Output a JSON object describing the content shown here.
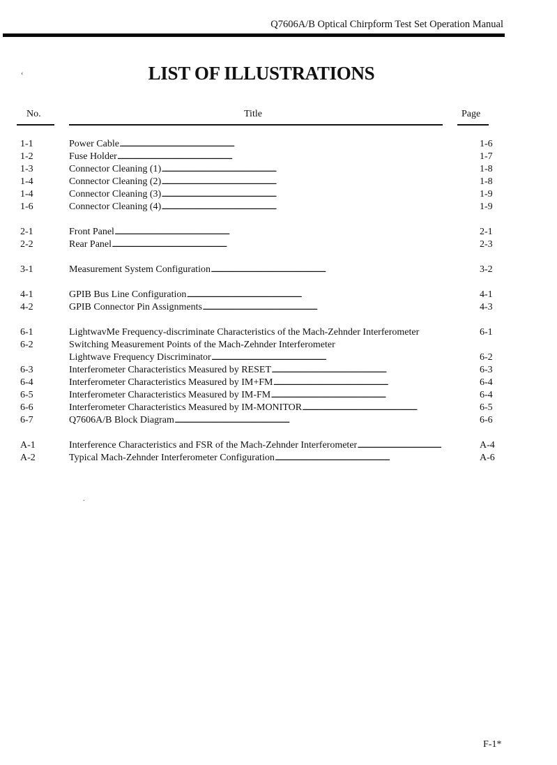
{
  "header": {
    "running_title": "Q7606A/B Optical Chirpform Test Set Operation Manual"
  },
  "page_title": "LIST OF ILLUSTRATIONS",
  "columns": {
    "no": "No.",
    "title": "Title",
    "page": "Page"
  },
  "entries": [
    {
      "no": "1-1",
      "title": "Power Cable",
      "page": "1-6"
    },
    {
      "no": "1-2",
      "title": "Fuse Holder",
      "page": "1-7"
    },
    {
      "no": "1-3",
      "title": "Connector Cleaning (1)",
      "page": "1-8"
    },
    {
      "no": "1-4",
      "title": "Connector Cleaning (2)",
      "page": "1-8"
    },
    {
      "no": "1-4",
      "title": "Connector Cleaning (3)",
      "page": "1-9"
    },
    {
      "no": "1-6",
      "title": "Connector Cleaning (4)",
      "page": "1-9"
    },
    {
      "no": "2-1",
      "title": "Front Panel",
      "page": "2-1"
    },
    {
      "no": "2-2",
      "title": "Rear Panel",
      "page": "2-3"
    },
    {
      "no": "3-1",
      "title": "Measurement System Configuration",
      "page": "3-2"
    },
    {
      "no": "4-1",
      "title": "GPIB Bus Line Configuration",
      "page": "4-1"
    },
    {
      "no": "4-2",
      "title": "GPIB Connector Pin Assignments",
      "page": "4-3"
    },
    {
      "no": "6-1",
      "title": "LightwavMe Frequency-discriminate Characteristics of the Mach-Zehnder Interferometer",
      "page": "6-1"
    },
    {
      "no": "6-2",
      "title": "Switching Measurement Points of the Mach-Zehnder Interferometer",
      "page": ""
    },
    {
      "no": "",
      "title": "Lightwave Frequency Discriminator",
      "page": "6-2"
    },
    {
      "no": "6-3",
      "title": "Interferometer Characteristics Measured by RESET",
      "page": "6-3"
    },
    {
      "no": "6-4",
      "title": "Interferometer Characteristics Measured by IM+FM",
      "page": "6-4"
    },
    {
      "no": "6-5",
      "title": "Interferometer Characteristics Measured by IM-FM",
      "page": "6-4"
    },
    {
      "no": "6-6",
      "title": "Interferometer Characteristics Measured by IM-MONITOR",
      "page": "6-5"
    },
    {
      "no": "6-7",
      "title": "Q7606A/B Block Diagram",
      "page": "6-6"
    },
    {
      "no": "A-1",
      "title": "Interference Characteristics and FSR of the Mach-Zehnder Interferometer",
      "page": "A-4"
    },
    {
      "no": "A-2",
      "title": "Typical Mach-Zehnder Interferometer Configuration",
      "page": "A-6"
    }
  ],
  "footer": {
    "page_number": "F-1*"
  }
}
